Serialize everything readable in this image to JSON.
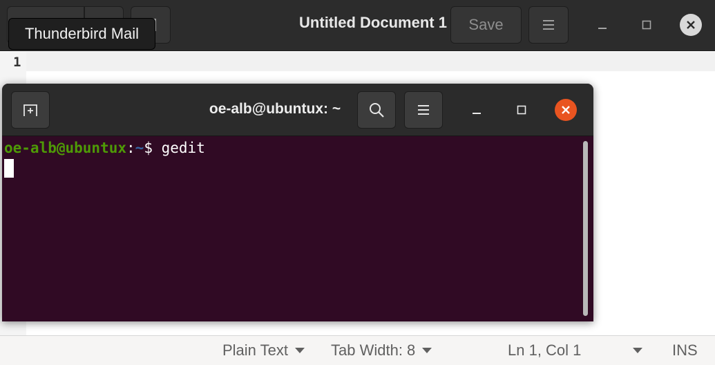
{
  "gedit": {
    "title": "Untitled Document 1",
    "save_label": "Save",
    "tooltip": "Thunderbird Mail",
    "line_number": "1",
    "status": {
      "language": "Plain Text",
      "tab_width": "Tab Width: 8",
      "position": "Ln 1, Col 1",
      "mode": "INS"
    }
  },
  "terminal": {
    "title": "oe-alb@ubuntux: ~",
    "prompt_user": "oe-alb@ubuntux",
    "prompt_colon": ":",
    "prompt_path": "~",
    "prompt_dollar": "$ ",
    "command": "gedit"
  },
  "colors": {
    "terminal_bg": "#300a24",
    "prompt_user": "#4e9a06",
    "prompt_path": "#3465a4",
    "close_orange": "#e95420"
  },
  "icons": {
    "gedit_menu": "hamburger-menu-icon",
    "terminal_new_tab": "new-tab-icon",
    "terminal_search": "search-icon",
    "terminal_menu": "hamburger-menu-icon",
    "window_minimize": "minimize-icon",
    "window_maximize": "maximize-icon",
    "window_close": "close-icon"
  }
}
